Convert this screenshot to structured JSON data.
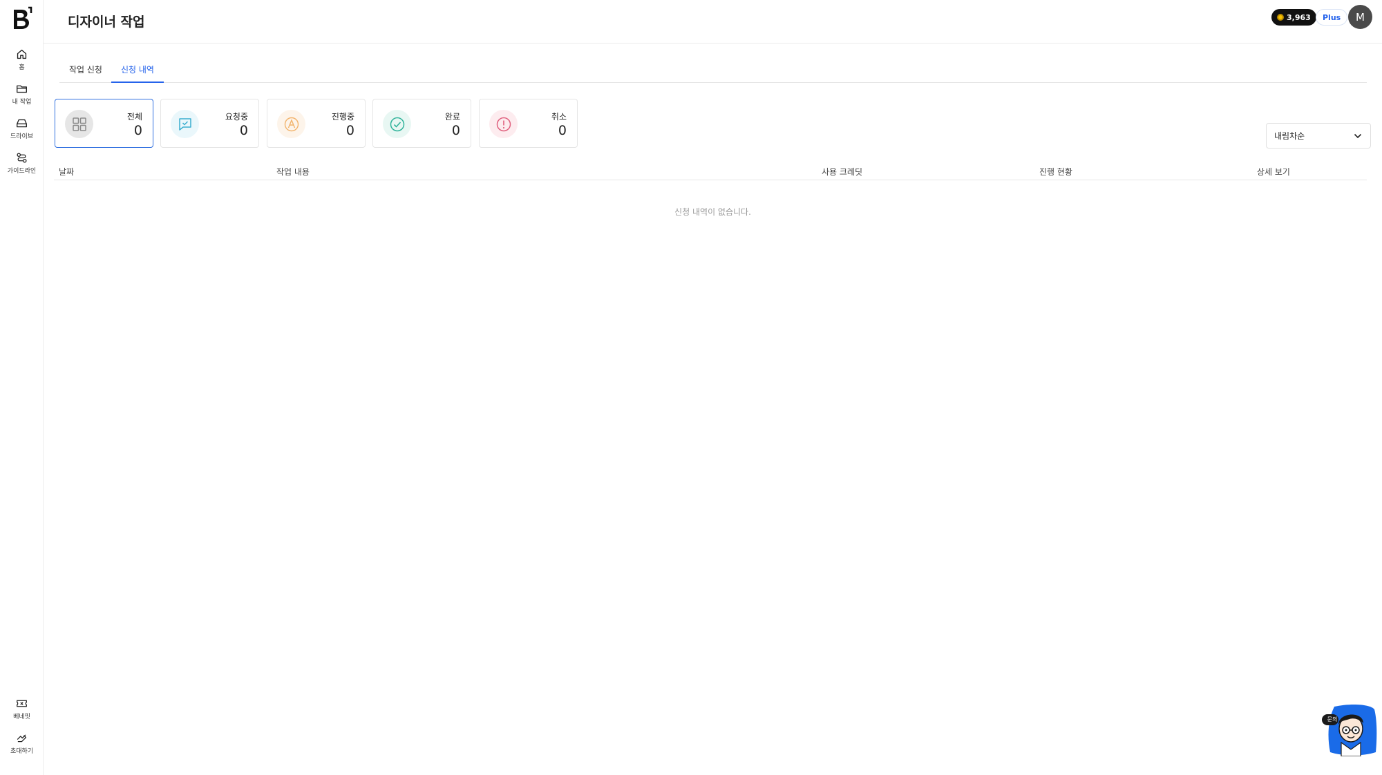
{
  "header": {
    "title": "디자이너 작업",
    "credits": "3,963",
    "plan": "Plus",
    "avatar_initial": "M"
  },
  "sidebar": {
    "items": [
      {
        "label": "홈",
        "icon": "home-icon"
      },
      {
        "label": "내 작업",
        "icon": "folder-icon"
      },
      {
        "label": "드라이브",
        "icon": "drive-icon"
      },
      {
        "label": "가이드라인",
        "icon": "guideline-icon"
      }
    ],
    "bottom_items": [
      {
        "label": "베네핏",
        "icon": "ticket-icon"
      },
      {
        "label": "초대하기",
        "icon": "invite-icon"
      }
    ]
  },
  "tabs": [
    {
      "label": "작업 신청",
      "active": false
    },
    {
      "label": "신청 내역",
      "active": true
    }
  ],
  "stats": [
    {
      "label": "전체",
      "count": "0",
      "icon": "grid-icon",
      "color": "#8a8a8a"
    },
    {
      "label": "요청중",
      "count": "0",
      "icon": "request-icon",
      "color": "#3aaed0"
    },
    {
      "label": "진행중",
      "count": "0",
      "icon": "in-progress-icon",
      "color": "#f2b36b"
    },
    {
      "label": "완료",
      "count": "0",
      "icon": "check-circle-icon",
      "color": "#2fb39a"
    },
    {
      "label": "취소",
      "count": "0",
      "icon": "alert-circle-icon",
      "color": "#e0607e"
    }
  ],
  "sort": {
    "selected": "내림차순"
  },
  "table": {
    "columns": [
      "날짜",
      "작업 내용",
      "사용 크레딧",
      "진행 현황",
      "상세 보기"
    ],
    "empty_message": "신청 내역이 없습니다."
  },
  "chatbot": {
    "badge": "문의"
  },
  "colors": {
    "accent": "#2563eb",
    "border": "#e5e5e5"
  }
}
